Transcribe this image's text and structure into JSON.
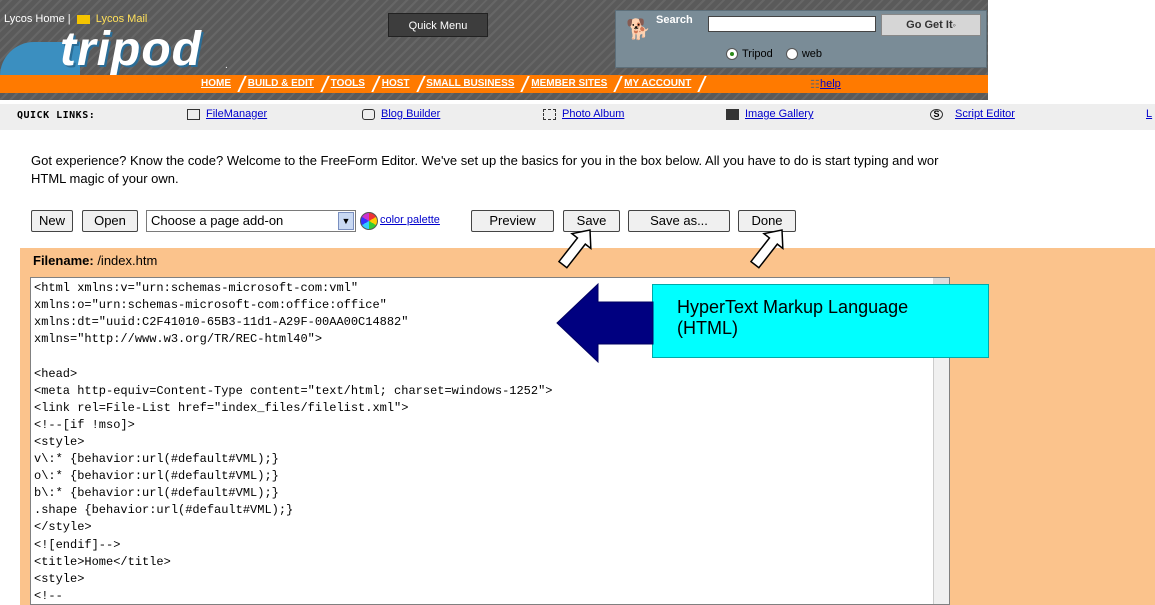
{
  "header": {
    "links": {
      "lycos_home": "Lycos Home",
      "separator": "|",
      "lycos_mail": "Lycos Mail"
    },
    "quick_menu": "Quick Menu",
    "logo_text": "tripod",
    "logo_dot": ".",
    "search": {
      "label": "Search",
      "input_value": "",
      "button": "Go Get It",
      "options": [
        {
          "label": "Tripod",
          "selected": true
        },
        {
          "label": "web",
          "selected": false
        }
      ]
    },
    "nav": [
      "HOME",
      "BUILD & EDIT",
      "TOOLS",
      "HOST",
      "SMALL BUSINESS",
      "MEMBER SITES",
      "MY ACCOUNT"
    ],
    "help": "help"
  },
  "quick_links": {
    "label": "QUICK LINKS:",
    "items": [
      {
        "label": "FileManager",
        "icon": "folder-icon"
      },
      {
        "label": "Blog Builder",
        "icon": "blog-icon"
      },
      {
        "label": "Photo Album",
        "icon": "photo-icon"
      },
      {
        "label": "Image Gallery",
        "icon": "gallery-icon"
      },
      {
        "label": "Script Editor",
        "icon": "script-icon"
      },
      {
        "label": "L",
        "icon": ""
      }
    ]
  },
  "intro": {
    "line1": "Got experience? Know the code? Welcome to the FreeForm Editor. We've set up the basics for you in the box below. All you have to do is start typing and wor",
    "line2": "HTML magic of your own."
  },
  "toolbar": {
    "new": "New",
    "open": "Open",
    "addon_select": "Choose a page add-on",
    "color_palette": "color palette",
    "preview": "Preview",
    "save": "Save",
    "save_as": "Save as...",
    "done": "Done"
  },
  "editor": {
    "filename_label": "Filename:",
    "filename_value": "/index.htm",
    "code_lines": [
      "<html xmlns:v=\"urn:schemas-microsoft-com:vml\"",
      "xmlns:o=\"urn:schemas-microsoft-com:office:office\"",
      "xmlns:dt=\"uuid:C2F41010-65B3-11d1-A29F-00AA00C14882\"",
      "xmlns=\"http://www.w3.org/TR/REC-html40\">",
      "",
      "<head>",
      "<meta http-equiv=Content-Type content=\"text/html; charset=windows-1252\">",
      "<link rel=File-List href=\"index_files/filelist.xml\">",
      "<!--[if !mso]>",
      "<style>",
      "v\\:* {behavior:url(#default#VML);}",
      "o\\:* {behavior:url(#default#VML);}",
      "b\\:* {behavior:url(#default#VML);}",
      ".shape {behavior:url(#default#VML);}",
      "</style>",
      "<![endif]-->",
      "<title>Home</title>",
      "<style>",
      "<!--"
    ]
  },
  "callout": {
    "line1": "HyperText Markup Language",
    "line2": "(HTML)"
  },
  "colors": {
    "nav_orange": "#ff7a00",
    "editor_bg": "#fbc38c",
    "callout_bg": "#00ffff",
    "arrow_blue": "#000080",
    "link_blue": "#0000cc"
  }
}
